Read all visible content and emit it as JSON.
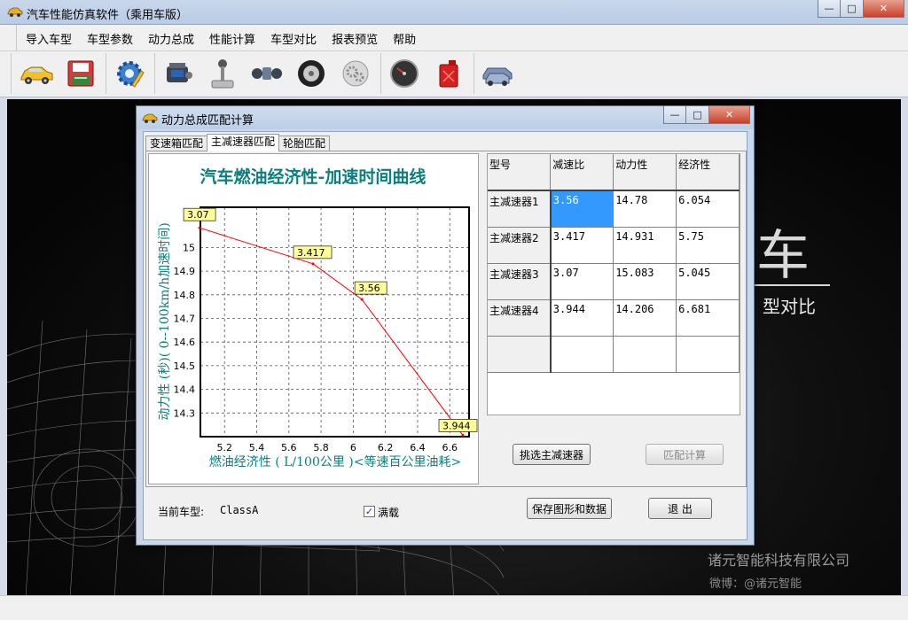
{
  "window": {
    "title": "汽车性能仿真软件（乘用车版）"
  },
  "menu": [
    "导入车型",
    "车型参数",
    "动力总成",
    "性能计算",
    "车型对比",
    "报表预览",
    "帮助"
  ],
  "toolbar_icons": [
    "car-icon",
    "save-icon",
    "settings-icon",
    "engine-icon",
    "gearshift-icon",
    "drivetrain-icon",
    "tire-icon",
    "gears-icon",
    "speedometer-icon",
    "fuel-can-icon",
    "vehicle-compare-icon"
  ],
  "background": {
    "brand_char": "车",
    "brand_sub": "型对比",
    "company": "诸元智能科技有限公司",
    "weibo": "微博：@诸元智能"
  },
  "dialog": {
    "title": "动力总成匹配计算",
    "tabs": [
      "变速箱匹配",
      "主减速器匹配",
      "轮胎匹配"
    ],
    "active_tab": 1,
    "table": {
      "headers": [
        "型号",
        "减速比",
        "动力性",
        "经济性"
      ],
      "rows": [
        [
          "主减速器1",
          "3.56",
          "14.78",
          "6.054"
        ],
        [
          "主减速器2",
          "3.417",
          "14.931",
          "5.75"
        ],
        [
          "主减速器3",
          "3.07",
          "15.083",
          "5.045"
        ],
        [
          "主减速器4",
          "3.944",
          "14.206",
          "6.681"
        ]
      ]
    },
    "select_button": "挑选主减速器",
    "match_button": "匹配计算",
    "current_model_label": "当前车型:",
    "current_model_value": "ClassA",
    "full_load_label": "满载",
    "full_load_checked": true,
    "save_button": "保存图形和数据",
    "exit_button": "退  出"
  },
  "chart_data": {
    "type": "line",
    "title": "汽车燃油经济性-加速时间曲线",
    "xlabel": "燃油经济性 ( L/100公里 )<等速百公里油耗>",
    "ylabel": "动力性 (秒)( 0--100km/h加速时间)",
    "xlim": [
      5.05,
      6.72
    ],
    "ylim": [
      14.2,
      15.17
    ],
    "xticks": [
      "5.2",
      "5.4",
      "5.6",
      "5.8",
      "6",
      "6.2",
      "6.4",
      "6.6"
    ],
    "yticks": [
      "14.3",
      "14.4",
      "14.5",
      "14.6",
      "14.7",
      "14.8",
      "14.9",
      "15"
    ],
    "grid": true,
    "line_color": "#ff0000",
    "points": [
      {
        "x": 5.045,
        "y": 15.083,
        "label": "3.07"
      },
      {
        "x": 5.75,
        "y": 14.931,
        "label": "3.417"
      },
      {
        "x": 6.054,
        "y": 14.78,
        "label": "3.56"
      },
      {
        "x": 6.681,
        "y": 14.206,
        "label": "3.944"
      }
    ]
  }
}
